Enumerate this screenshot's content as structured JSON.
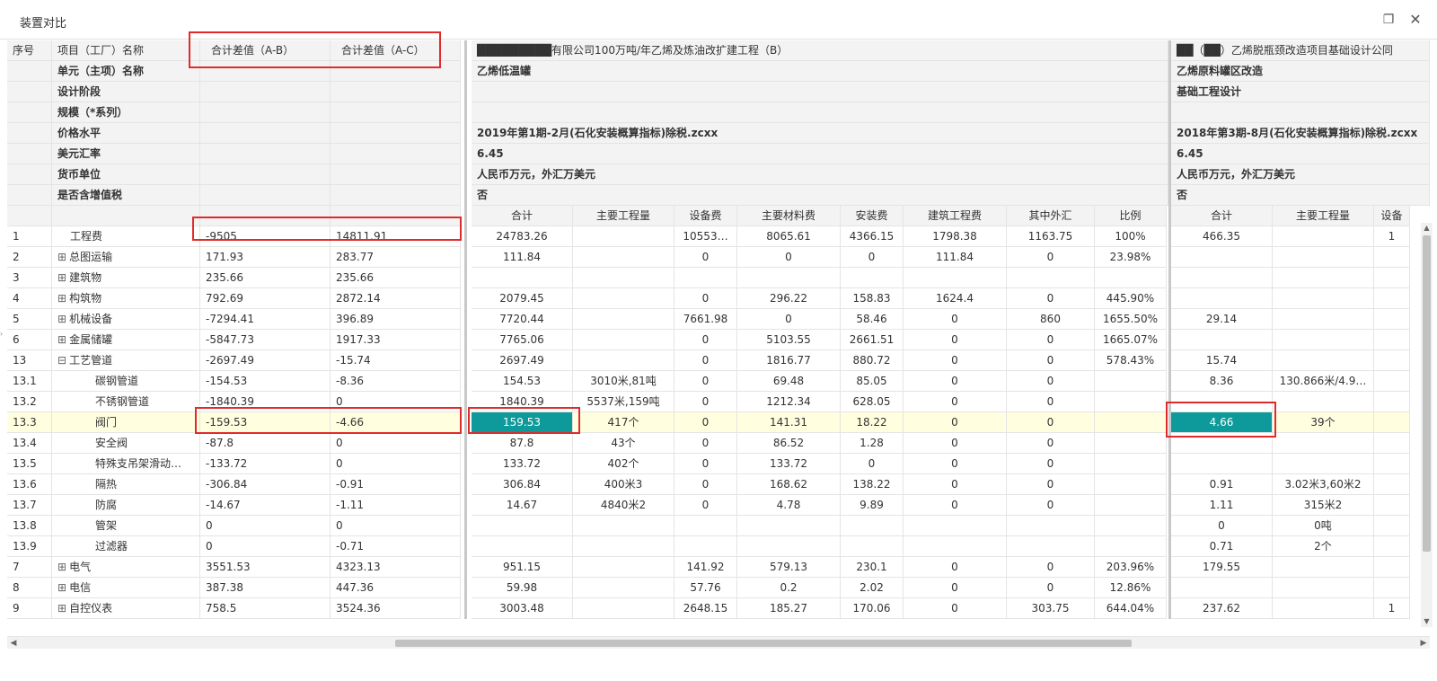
{
  "window": {
    "title": "装置对比"
  },
  "info_labels": [
    "单元（主项）名称",
    "设计阶段",
    "规模（*系列）",
    "价格水平",
    "美元汇率",
    "货币单位",
    "是否含增值税"
  ],
  "fixed_headers": {
    "seq": "序号",
    "name": "项目（工厂）名称",
    "diff_ab": "合计差值（A-B）",
    "diff_ac": "合计差值（A-C）"
  },
  "project_b": {
    "title": "█████████有限公司100万吨/年乙烯及炼油改扩建工程（B）",
    "unit_name": "乙烯低温罐",
    "design_stage": "",
    "scale": "",
    "price_level": "2019年第1期-2月(石化安装概算指标)除税.zcxx",
    "exchange_rate": "6.45",
    "currency": "人民币万元，外汇万美元",
    "vat": "否"
  },
  "project_c": {
    "title": "██（██）乙烯脱瓶颈改造项目基础设计公同",
    "unit_name": "乙烯原料罐区改造",
    "design_stage": "基础工程设计",
    "scale": "",
    "price_level": "2018年第3期-8月(石化安装概算指标)除税.zcxx",
    "exchange_rate": "6.45",
    "currency": "人民币万元，外汇万美元",
    "vat": "否"
  },
  "b_columns": [
    "合计",
    "主要工程量",
    "设备费",
    "主要材料费",
    "安装费",
    "建筑工程费",
    "其中外汇",
    "比例"
  ],
  "c_columns": [
    "合计",
    "主要工程量",
    "设备"
  ],
  "rows": [
    {
      "seq": "1",
      "name": "工程费",
      "expand": "",
      "indent": 1,
      "diff_ab": "-9505",
      "diff_ac": "14811.91",
      "b": [
        "24783.26",
        "",
        "10553…",
        "8065.61",
        "4366.15",
        "1798.38",
        "1163.75",
        "100%"
      ],
      "c": [
        "466.35",
        "",
        "1"
      ]
    },
    {
      "seq": "2",
      "name": "总图运输",
      "expand": "⊞",
      "indent": 0,
      "diff_ab": "171.93",
      "diff_ac": "283.77",
      "b": [
        "111.84",
        "",
        "0",
        "0",
        "0",
        "111.84",
        "0",
        "23.98%"
      ],
      "c": [
        "",
        "",
        ""
      ]
    },
    {
      "seq": "3",
      "name": "建筑物",
      "expand": "⊞",
      "indent": 0,
      "diff_ab": "235.66",
      "diff_ac": "235.66",
      "b": [
        "",
        "",
        "",
        "",
        "",
        "",
        "",
        ""
      ],
      "c": [
        "",
        "",
        ""
      ]
    },
    {
      "seq": "4",
      "name": "构筑物",
      "expand": "⊞",
      "indent": 0,
      "diff_ab": "792.69",
      "diff_ac": "2872.14",
      "b": [
        "2079.45",
        "",
        "0",
        "296.22",
        "158.83",
        "1624.4",
        "0",
        "445.90%"
      ],
      "c": [
        "",
        "",
        ""
      ]
    },
    {
      "seq": "5",
      "name": "机械设备",
      "expand": "⊞",
      "indent": 0,
      "diff_ab": "-7294.41",
      "diff_ac": "396.89",
      "b": [
        "7720.44",
        "",
        "7661.98",
        "0",
        "58.46",
        "0",
        "860",
        "1655.50%"
      ],
      "c": [
        "29.14",
        "",
        ""
      ]
    },
    {
      "seq": "6",
      "name": "金属储罐",
      "expand": "⊞",
      "indent": 0,
      "diff_ab": "-5847.73",
      "diff_ac": "1917.33",
      "b": [
        "7765.06",
        "",
        "0",
        "5103.55",
        "2661.51",
        "0",
        "0",
        "1665.07%"
      ],
      "c": [
        "",
        "",
        ""
      ]
    },
    {
      "seq": "13",
      "name": "工艺管道",
      "expand": "⊟",
      "indent": 0,
      "diff_ab": "-2697.49",
      "diff_ac": "-15.74",
      "b": [
        "2697.49",
        "",
        "0",
        "1816.77",
        "880.72",
        "0",
        "0",
        "578.43%"
      ],
      "c": [
        "15.74",
        "",
        ""
      ]
    },
    {
      "seq": "13.1",
      "name": "碳钢管道",
      "expand": "",
      "indent": 2,
      "diff_ab": "-154.53",
      "diff_ac": "-8.36",
      "b": [
        "154.53",
        "3010米,81吨",
        "0",
        "69.48",
        "85.05",
        "0",
        "0",
        ""
      ],
      "c": [
        "8.36",
        "130.866米/4.9…",
        ""
      ]
    },
    {
      "seq": "13.2",
      "name": "不锈钢管道",
      "expand": "",
      "indent": 2,
      "diff_ab": "-1840.39",
      "diff_ac": "0",
      "b": [
        "1840.39",
        "5537米,159吨",
        "0",
        "1212.34",
        "628.05",
        "0",
        "0",
        ""
      ],
      "c": [
        "",
        "",
        ""
      ]
    },
    {
      "seq": "13.3",
      "name": "阀门",
      "expand": "",
      "indent": 2,
      "diff_ab": "-159.53",
      "diff_ac": "-4.66",
      "b": [
        "159.53",
        "417个",
        "0",
        "141.31",
        "18.22",
        "0",
        "0",
        ""
      ],
      "c": [
        "4.66",
        "39个",
        ""
      ],
      "highlight": true
    },
    {
      "seq": "13.4",
      "name": "安全阀",
      "expand": "",
      "indent": 2,
      "diff_ab": "-87.8",
      "diff_ac": "0",
      "b": [
        "87.8",
        "43个",
        "0",
        "86.52",
        "1.28",
        "0",
        "0",
        ""
      ],
      "c": [
        "",
        "",
        ""
      ]
    },
    {
      "seq": "13.5",
      "name": "特殊支吊架滑动…",
      "expand": "",
      "indent": 2,
      "diff_ab": "-133.72",
      "diff_ac": "0",
      "b": [
        "133.72",
        "402个",
        "0",
        "133.72",
        "0",
        "0",
        "0",
        ""
      ],
      "c": [
        "",
        "",
        ""
      ]
    },
    {
      "seq": "13.6",
      "name": "隔热",
      "expand": "",
      "indent": 2,
      "diff_ab": "-306.84",
      "diff_ac": "-0.91",
      "b": [
        "306.84",
        "400米3",
        "0",
        "168.62",
        "138.22",
        "0",
        "0",
        ""
      ],
      "c": [
        "0.91",
        "3.02米3,60米2",
        ""
      ]
    },
    {
      "seq": "13.7",
      "name": "防腐",
      "expand": "",
      "indent": 2,
      "diff_ab": "-14.67",
      "diff_ac": "-1.11",
      "b": [
        "14.67",
        "4840米2",
        "0",
        "4.78",
        "9.89",
        "0",
        "0",
        ""
      ],
      "c": [
        "1.11",
        "315米2",
        ""
      ]
    },
    {
      "seq": "13.8",
      "name": "管架",
      "expand": "",
      "indent": 2,
      "diff_ab": "0",
      "diff_ac": "0",
      "b": [
        "",
        "",
        "",
        "",
        "",
        "",
        "",
        ""
      ],
      "c": [
        "0",
        "0吨",
        ""
      ]
    },
    {
      "seq": "13.9",
      "name": "过滤器",
      "expand": "",
      "indent": 2,
      "diff_ab": "0",
      "diff_ac": "-0.71",
      "b": [
        "",
        "",
        "",
        "",
        "",
        "",
        "",
        ""
      ],
      "c": [
        "0.71",
        "2个",
        ""
      ]
    },
    {
      "seq": "7",
      "name": "电气",
      "expand": "⊞",
      "indent": 0,
      "diff_ab": "3551.53",
      "diff_ac": "4323.13",
      "b": [
        "951.15",
        "",
        "141.92",
        "579.13",
        "230.1",
        "0",
        "0",
        "203.96%"
      ],
      "c": [
        "179.55",
        "",
        ""
      ]
    },
    {
      "seq": "8",
      "name": "电信",
      "expand": "⊞",
      "indent": 0,
      "diff_ab": "387.38",
      "diff_ac": "447.36",
      "b": [
        "59.98",
        "",
        "57.76",
        "0.2",
        "2.02",
        "0",
        "0",
        "12.86%"
      ],
      "c": [
        "",
        "",
        ""
      ]
    },
    {
      "seq": "9",
      "name": "自控仪表",
      "expand": "⊞",
      "indent": 0,
      "diff_ab": "758.5",
      "diff_ac": "3524.36",
      "b": [
        "3003.48",
        "",
        "2648.15",
        "185.27",
        "170.06",
        "0",
        "303.75",
        "644.04%"
      ],
      "c": [
        "237.62",
        "",
        "1"
      ]
    }
  ],
  "highlight_colors": {
    "teal": "#0e9a9a",
    "row": "#ffffe0",
    "box": "#e02b2b"
  },
  "icons": {
    "restore": "restore-icon",
    "close": "close-icon"
  }
}
